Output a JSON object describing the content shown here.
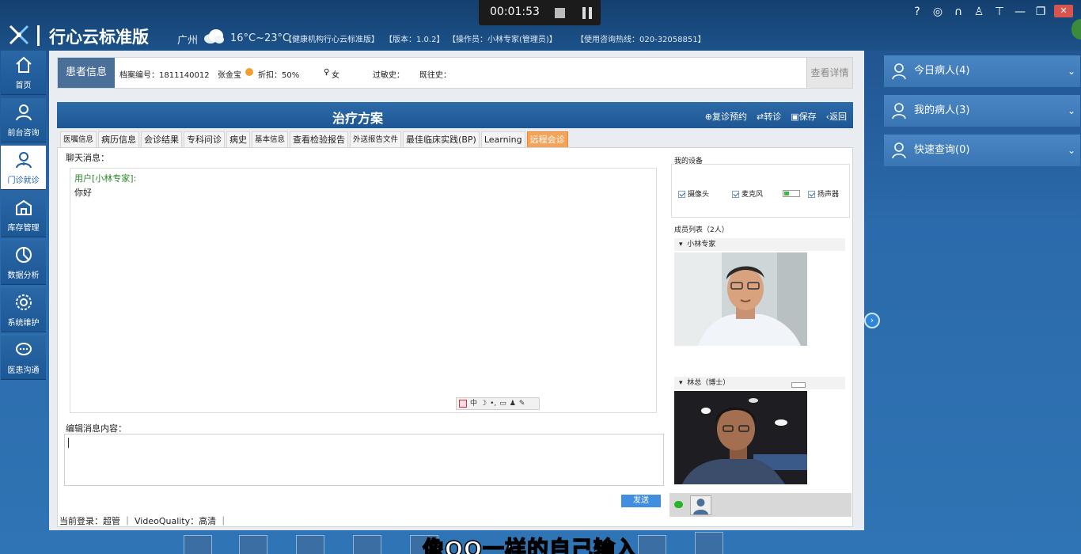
{
  "header": {
    "app_title": "行心云标准版",
    "city": "广州",
    "weather_icon": "cloud-icon",
    "temperature": "16°C~23°C",
    "org": "【健康机构行心云标准版】",
    "version": "【版本：1.0.2】",
    "operator": "【操作员：小林专家(管理员)】",
    "hotline": "【使用咨询热线：020-32058851】"
  },
  "recorder": {
    "time": "00:01:53"
  },
  "top_icons": [
    "help-icon",
    "wechat-icon",
    "headset-icon",
    "user-icon",
    "shirt-icon",
    "minimize-icon",
    "restore-icon",
    "close-icon"
  ],
  "nav": {
    "items": [
      {
        "label": "首页",
        "icon": "home-icon"
      },
      {
        "label": "前台咨询",
        "icon": "reception-icon"
      },
      {
        "label": "门诊就诊",
        "icon": "doctor-icon"
      },
      {
        "label": "库存管理",
        "icon": "warehouse-icon"
      },
      {
        "label": "数据分析",
        "icon": "analysis-icon"
      },
      {
        "label": "系统维护",
        "icon": "settings-icon"
      },
      {
        "label": "医患沟通",
        "icon": "chat-icon"
      }
    ]
  },
  "patient": {
    "title": "患者信息",
    "record_no": "档案编号：1811140012",
    "name": "张金宝",
    "discount": "折扣：50%",
    "gender": "女",
    "allergy": "过敏史：",
    "history": "既往史：",
    "detail_button": "查看详情"
  },
  "plan": {
    "title": "治疗方案",
    "followup": "复诊预约",
    "transfer": "转诊",
    "save": "保存",
    "back": "返回"
  },
  "tabs": [
    {
      "label": "医嘱信息"
    },
    {
      "label": "病历信息"
    },
    {
      "label": "会诊结果"
    },
    {
      "label": "专科问诊"
    },
    {
      "label": "病史"
    },
    {
      "label": "基本信息"
    },
    {
      "label": "查看检验报告"
    },
    {
      "label": "外送报告文件"
    },
    {
      "label": "最佳临床实践(BP)"
    },
    {
      "label": "Learning"
    },
    {
      "label": "远程会诊"
    }
  ],
  "chat": {
    "label": "聊天消息：",
    "user": "用户[小林专家]:",
    "message": "你好",
    "tools": [
      "中",
      "☽",
      "•,",
      "▭",
      "♟",
      "✎"
    ]
  },
  "editor": {
    "label": "编辑消息内容：",
    "value": "",
    "send": "发送"
  },
  "status": {
    "login": "当前登录：超管",
    "quality": "VideoQuality：高清"
  },
  "devices": {
    "title": "我的设备",
    "camera": "摄像头",
    "mic": "麦克风",
    "speaker": "扬声器",
    "mic_level": 0.3
  },
  "members": {
    "label": "成员列表（2人）",
    "list": [
      {
        "name": "小林专家"
      },
      {
        "name": "林总（博士）"
      }
    ]
  },
  "right_panel": {
    "items": [
      {
        "label": "今日病人(4)"
      },
      {
        "label": "我的病人(3)"
      },
      {
        "label": "快速查询(0)"
      }
    ]
  },
  "subtitle": "像QQ一样的自己输入"
}
